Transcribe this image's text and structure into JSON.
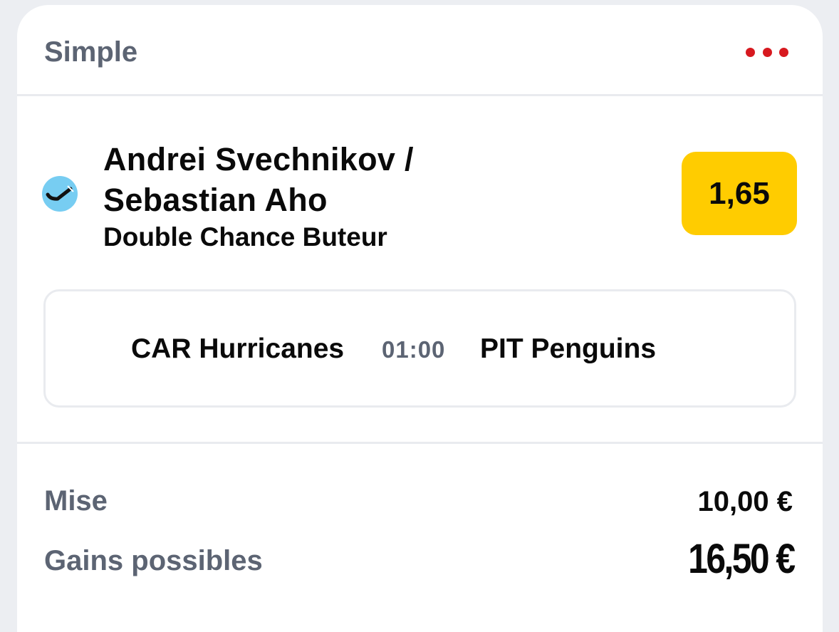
{
  "header": {
    "bet_type": "Simple",
    "menu_icon": "more-dots-icon",
    "accent_color": "#d7191f"
  },
  "selection": {
    "sport_icon": "hockey-stick-icon",
    "name": "Andrei Svechnikov / Sebastian Aho",
    "market": "Double Chance Buteur",
    "odds": "1,65",
    "odds_color": "#ffcc00"
  },
  "match": {
    "home_team": "CAR Hurricanes",
    "time": "01:00",
    "away_team": "PIT Penguins"
  },
  "summary": {
    "stake_label": "Mise",
    "stake_value": "10,00 €",
    "winnings_label": "Gains possibles",
    "winnings_value": "16,50 €"
  }
}
